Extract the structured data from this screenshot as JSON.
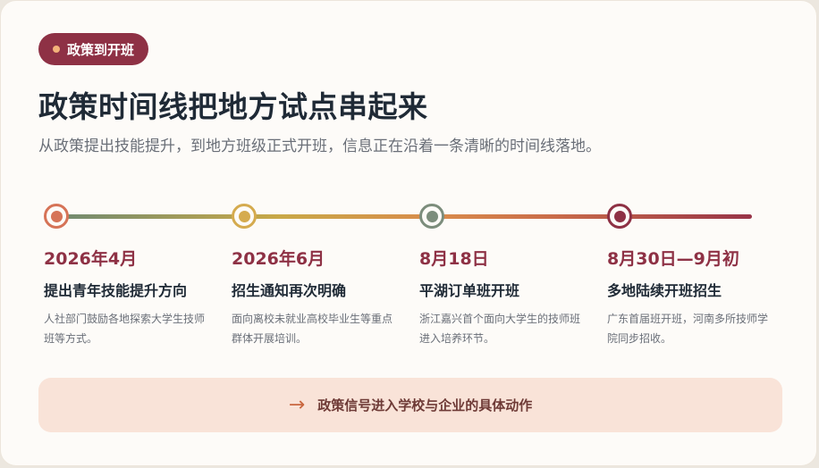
{
  "badge": {
    "label": "政策到开班"
  },
  "title": "政策时间线把地方试点串起来",
  "subtitle": "从政策提出技能提升，到地方班级正式开班，信息正在沿着一条清晰的时间线落地。",
  "timeline": [
    {
      "date": "2026年4月",
      "heading": "提出青年技能提升方向",
      "desc": "人社部门鼓励各地探索大学生技师班等方式。",
      "ring_color": "#d67357",
      "dot_color": "#d67357"
    },
    {
      "date": "2026年6月",
      "heading": "招生通知再次明确",
      "desc": "面向离校未就业高校毕业生等重点群体开展培训。",
      "ring_color": "#d5ab4f",
      "dot_color": "#d5ab4f"
    },
    {
      "date": "8月18日",
      "heading": "平湖订单班开班",
      "desc": "浙江嘉兴首个面向大学生的技师班进入培养环节。",
      "ring_color": "#7c8d7c",
      "dot_color": "#7c8d7c"
    },
    {
      "date": "8月30日—9月初",
      "heading": "多地陆续开班招生",
      "desc": "广东首届班开班，河南多所技师学院同步招收。",
      "ring_color": "#8e3145",
      "dot_color": "#8e3145"
    }
  ],
  "banner": {
    "icon": "arrow-right-icon",
    "arrow": "→",
    "text": "政策信号进入学校与企业的具体动作"
  },
  "colors": {
    "accent": "#8e3145",
    "title": "#1f2a36",
    "banner_bg": "#f9e3d8"
  }
}
